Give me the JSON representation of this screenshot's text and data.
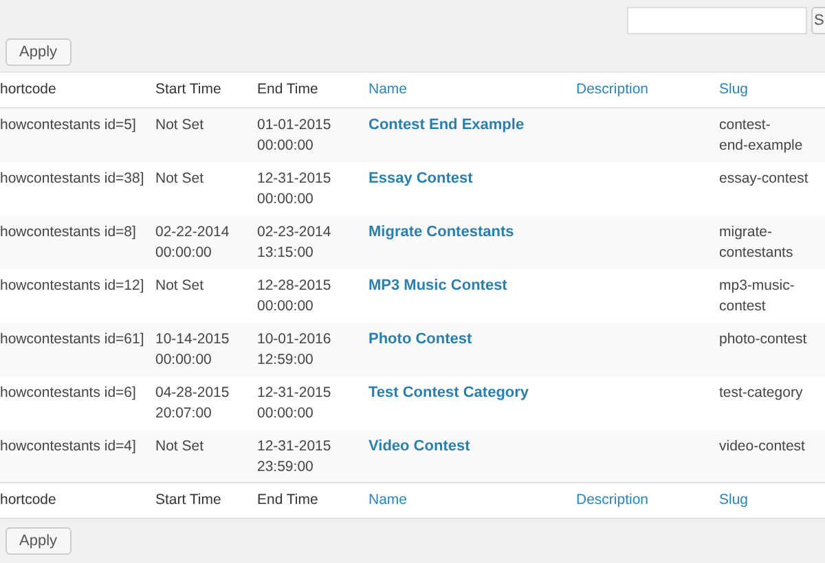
{
  "search": {
    "button": "S"
  },
  "top_actions": {
    "apply": "Apply"
  },
  "table": {
    "columns": [
      {
        "label": "hortcode",
        "sortable": false
      },
      {
        "label": "Start Time",
        "sortable": false
      },
      {
        "label": "End Time",
        "sortable": false
      },
      {
        "label": "Name",
        "sortable": true
      },
      {
        "label": "Description",
        "sortable": true
      },
      {
        "label": "Slug",
        "sortable": true
      }
    ],
    "rows": [
      {
        "shortcode": "howcontestants id=5]",
        "start": [
          "Not Set"
        ],
        "end": [
          "01-01-2015",
          "00:00:00"
        ],
        "name": "Contest End Example",
        "description": "",
        "slug": [
          "contest-",
          "end-example"
        ]
      },
      {
        "shortcode": "howcontestants id=38]",
        "start": [
          "Not Set"
        ],
        "end": [
          "12-31-2015",
          "00:00:00"
        ],
        "name": "Essay Contest",
        "description": "",
        "slug": [
          "essay-contest"
        ]
      },
      {
        "shortcode": "howcontestants id=8]",
        "start": [
          "02-22-2014",
          "00:00:00"
        ],
        "end": [
          "02-23-2014",
          "13:15:00"
        ],
        "name": "Migrate Contestants",
        "description": "",
        "slug": [
          "migrate-",
          "contestants"
        ]
      },
      {
        "shortcode": "howcontestants id=12]",
        "start": [
          "Not Set"
        ],
        "end": [
          "12-28-2015",
          "00:00:00"
        ],
        "name": "MP3 Music Contest",
        "description": "",
        "slug": [
          "mp3-music-",
          "contest"
        ]
      },
      {
        "shortcode": "howcontestants id=61]",
        "start": [
          "10-14-2015",
          "00:00:00"
        ],
        "end": [
          "10-01-2016",
          "12:59:00"
        ],
        "name": "Photo Contest",
        "description": "",
        "slug": [
          "photo-contest"
        ]
      },
      {
        "shortcode": "howcontestants id=6]",
        "start": [
          "04-28-2015",
          "20:07:00"
        ],
        "end": [
          "12-31-2015",
          "00:00:00"
        ],
        "name": "Test Contest Category",
        "description": "",
        "slug": [
          "test-category"
        ]
      },
      {
        "shortcode": "howcontestants id=4]",
        "start": [
          "Not Set"
        ],
        "end": [
          "12-31-2015",
          "23:59:00"
        ],
        "name": "Video Contest",
        "description": "",
        "slug": [
          "video-contest"
        ]
      }
    ],
    "footer_columns": [
      {
        "label": "hortcode",
        "sortable": false
      },
      {
        "label": "Start Time",
        "sortable": false
      },
      {
        "label": "End Time",
        "sortable": false
      },
      {
        "label": "Name",
        "sortable": true
      },
      {
        "label": "Description",
        "sortable": true
      },
      {
        "label": "Slug",
        "sortable": true
      }
    ]
  },
  "bottom_actions": {
    "apply": "Apply"
  }
}
